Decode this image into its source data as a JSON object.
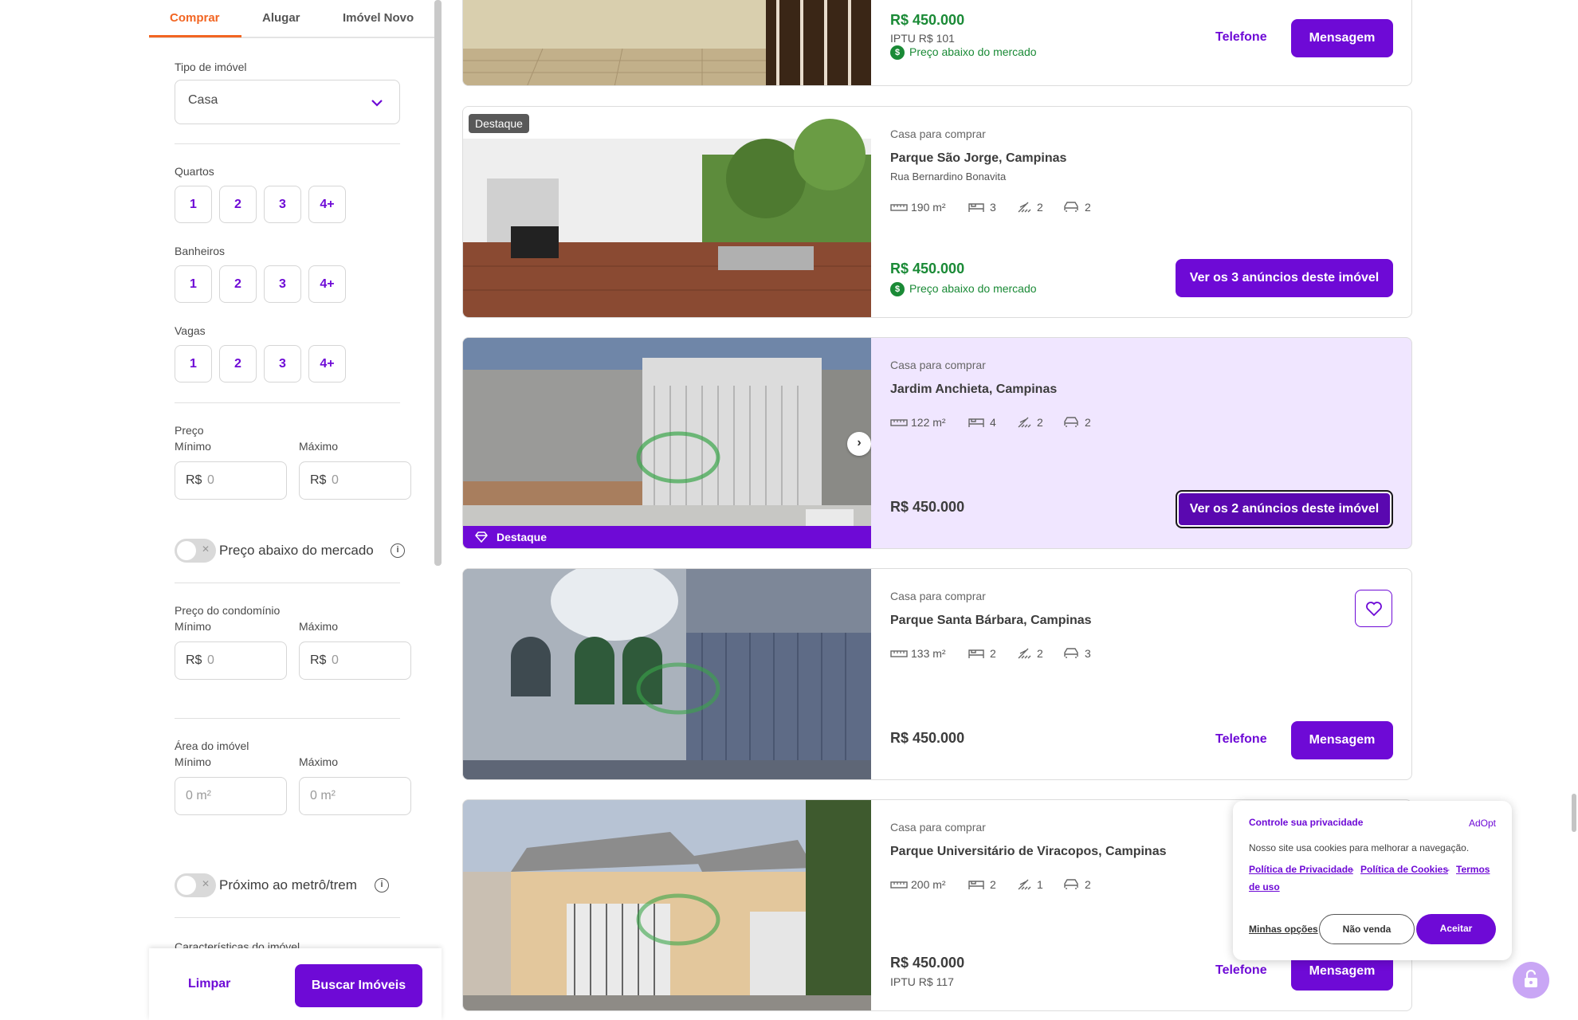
{
  "tabs": [
    "Comprar",
    "Alugar",
    "Imóvel Novo"
  ],
  "filters": {
    "property_type_label": "Tipo de imóvel",
    "property_type_value": "Casa",
    "bedrooms_label": "Quartos",
    "bathrooms_label": "Banheiros",
    "parking_label": "Vagas",
    "options": [
      "1",
      "2",
      "3",
      "4+"
    ],
    "price_label": "Preço",
    "min_label": "Mínimo",
    "max_label": "Máximo",
    "currency": "R$",
    "currency_placeholder": "0",
    "below_market_label": "Preço abaixo do mercado",
    "condo_label": "Preço do condomínio",
    "area_label": "Área do imóvel",
    "area_placeholder": "0 m²",
    "metro_label": "Próximo ao metrô/trem",
    "features_label": "Características do imóvel",
    "clear_label": "Limpar",
    "search_label": "Buscar Imóveis"
  },
  "listings": [
    {
      "price": "R$ 450.000",
      "iptu": "IPTU R$ 101",
      "market": "Preço abaixo do mercado",
      "phone_label": "Telefone",
      "message_label": "Mensagem"
    },
    {
      "badge": "Destaque",
      "type": "Casa para comprar",
      "title": "Parque São Jorge, Campinas",
      "address": "Rua Bernardino Bonavita",
      "area": "190 m²",
      "bedrooms": "3",
      "bathrooms": "2",
      "parking": "2",
      "price": "R$ 450.000",
      "market": "Preço abaixo do mercado",
      "cta": "Ver os 3 anúncios deste imóvel"
    },
    {
      "type": "Casa para comprar",
      "title": "Jardim Anchieta, Campinas",
      "area": "122 m²",
      "bedrooms": "4",
      "bathrooms": "2",
      "parking": "2",
      "price": "R$ 450.000",
      "featured": "Destaque",
      "cta": "Ver os 2 anúncios deste imóvel"
    },
    {
      "type": "Casa para comprar",
      "title": "Parque Santa Bárbara, Campinas",
      "area": "133 m²",
      "bedrooms": "2",
      "bathrooms": "2",
      "parking": "3",
      "price": "R$ 450.000",
      "phone_label": "Telefone",
      "message_label": "Mensagem"
    },
    {
      "type": "Casa para comprar",
      "title": "Parque Universitário de Viracopos, Campinas",
      "area": "200 m²",
      "bedrooms": "2",
      "bathrooms": "1",
      "parking": "2",
      "price": "R$ 450.000",
      "iptu": "IPTU R$ 117",
      "phone_label": "Telefone",
      "message_label": "Mensagem"
    }
  ],
  "cookie": {
    "title": "Controle sua privacidade",
    "brand": "AdOpt",
    "text": "Nosso site usa cookies para melhorar a navegação.",
    "privacy_link": "Política de Privacidade",
    "sep": "-",
    "cookies_link": "Política de Cookies",
    "terms_link_1": "Termos",
    "terms_link_2": "de uso",
    "options_label": "Minhas opções",
    "no_sell_label": "Não venda",
    "accept_label": "Aceitar"
  },
  "colors": {
    "accent": "#6e0ad6",
    "tab_active": "#f26522",
    "price_green": "#1a8a36",
    "highlight_bg": "#f0e6ff"
  }
}
